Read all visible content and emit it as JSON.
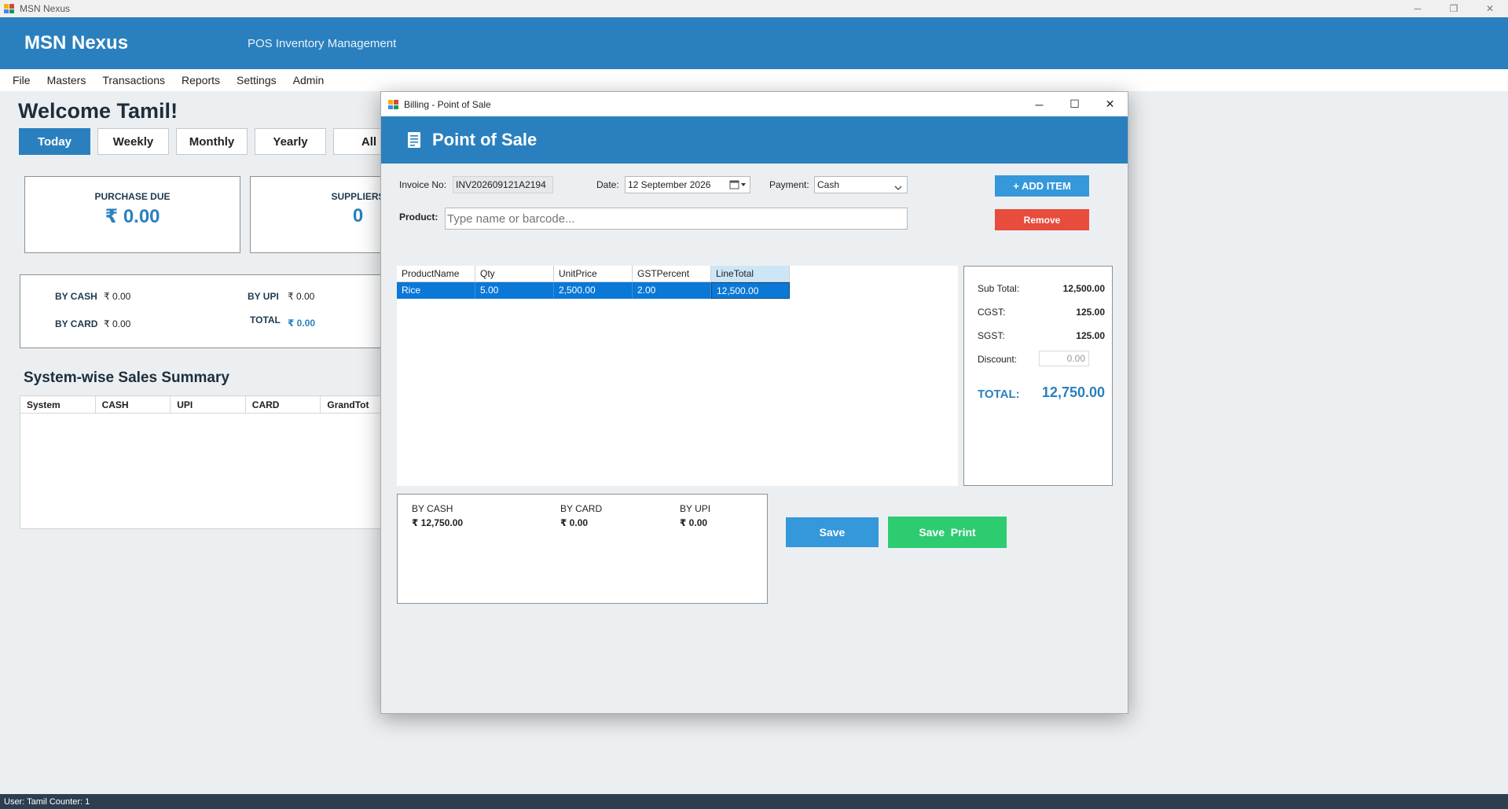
{
  "window": {
    "title": "MSN Nexus",
    "minimize_glyph": "─",
    "maximize_glyph": "❐",
    "close_glyph": "✕"
  },
  "header": {
    "brand": "MSN Nexus",
    "tagline": "POS  Inventory Management",
    "color": "#2a80be"
  },
  "menu": [
    "File",
    "Masters",
    "Transactions",
    "Reports",
    "Settings",
    "Admin"
  ],
  "dashboard": {
    "welcome": "Welcome Tamil!",
    "tabs": [
      "Today",
      "Weekly",
      "Monthly",
      "Yearly",
      "All"
    ],
    "active_tab": "Today",
    "cards": [
      {
        "label": "PURCHASE DUE",
        "value": "₹ 0.00"
      },
      {
        "label": "SUPPLIERS",
        "value": "0"
      }
    ],
    "payments": {
      "by_cash_label": "BY CASH",
      "by_cash_value": "₹ 0.00",
      "by_upi_label": "BY UPI",
      "by_upi_value": "₹ 0.00",
      "by_card_label": "BY CARD",
      "by_card_value": "₹ 0.00",
      "total_label": "TOTAL",
      "total_value": "₹ 0.00"
    },
    "system_summary": {
      "title": "System-wise Sales Summary",
      "columns": [
        "System",
        "CASH",
        "UPI",
        "CARD",
        "GrandTot"
      ]
    }
  },
  "status_bar": "User: Tamil   Counter: 1",
  "dialog": {
    "title": "Billing - Point of Sale",
    "heading": "Point of Sale",
    "minimize_glyph": "─",
    "maximize_glyph": "☐",
    "close_glyph": "✕",
    "invoice_label": "Invoice No:",
    "invoice_value": "INV202609121A2194",
    "date_label": "Date:",
    "date_value": "12 September 2026",
    "payment_label": "Payment:",
    "payment_value": "Cash",
    "add_item": "+ ADD ITEM",
    "remove": "Remove",
    "product_label": "Product:",
    "product_placeholder": "Type name or barcode...",
    "grid": {
      "columns": [
        "ProductName",
        "Qty",
        "UnitPrice",
        "GSTPercent",
        "LineTotal"
      ],
      "rows": [
        {
          "ProductName": "Rice",
          "Qty": "5.00",
          "UnitPrice": "2,500.00",
          "GSTPercent": "2.00",
          "LineTotal": "12,500.00"
        }
      ]
    },
    "totals": {
      "subtotal_label": "Sub Total:",
      "subtotal_value": "12,500.00",
      "cgst_label": "CGST:",
      "cgst_value": "125.00",
      "sgst_label": "SGST:",
      "sgst_value": "125.00",
      "discount_label": "Discount:",
      "discount_value": "0.00",
      "total_label": "TOTAL:",
      "total_value": "12,750.00"
    },
    "breakdown": {
      "by_cash_label": "BY CASH",
      "by_cash_value": "₹ 12,750.00",
      "by_card_label": "BY CARD",
      "by_card_value": "₹ 0.00",
      "by_upi_label": "BY UPI",
      "by_upi_value": "₹ 0.00"
    },
    "save": "Save",
    "save_print": "Save  Print",
    "colors": {
      "blue": "#2a80be",
      "button_blue": "#3498db",
      "red": "#e74c3c",
      "green": "#2ecc71",
      "selection": "#0a78d7"
    }
  }
}
